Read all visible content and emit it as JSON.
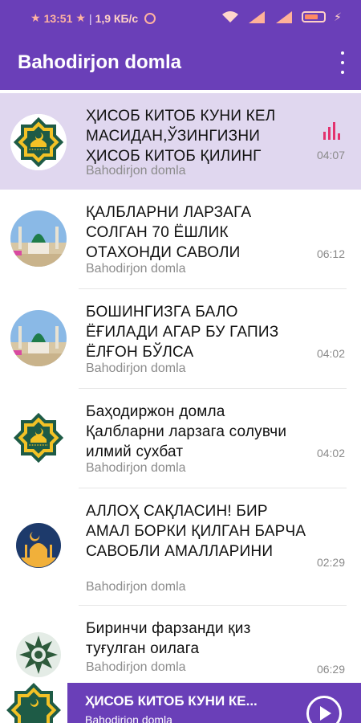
{
  "status_bar": {
    "time": "13:51",
    "star_left": "★",
    "star_right": "★",
    "separator": "|",
    "speed": "1,9 КБ/с",
    "accent_color": "#ff8a65"
  },
  "app_bar": {
    "title": "Bahodirjon domla",
    "menu_icon": "more-vert-icon",
    "color": "#6a3fb8"
  },
  "tracks": [
    {
      "title": "ҲИСОБ КИТОБ КУНИ КЕЛ МАСИДАН,ЎЗИНГИЗНИ ҲИСОБ КИТОБ ҚИЛИНГ",
      "artist": "Bahodirjon domla",
      "duration": "04:07",
      "playing": true,
      "thumb": "octagram-mosque-icon"
    },
    {
      "title": "ҚАЛБЛАРНИ ЛАРЗАГА СОЛГАН 70 ЁШЛИК ОТАХОНДИ САВОЛИ",
      "artist": "Bahodirjon domla",
      "duration": "06:12",
      "playing": false,
      "thumb": "mosque-photo-icon"
    },
    {
      "title": "БОШИНГИЗГА БАЛО ЁҒИЛАДИ АГАР БУ ГАПИЗ ЁЛҒОН БЎЛСА",
      "artist": "Bahodirjon domla",
      "duration": "04:02",
      "playing": false,
      "thumb": "mosque-photo-icon"
    },
    {
      "title": "Баҳодиржон домла Қалбларни ларзага солувчи илмий сухбат",
      "artist": "Bahodirjon domla",
      "duration": "04:02",
      "playing": false,
      "thumb": "octagram-mosque-icon"
    },
    {
      "title": "АЛЛОҲ САҚЛАСИН! БИР АМАЛ БОРКИ ҚИЛГАН БАРЧА САВОБЛИ АМАЛЛАРИНИ",
      "artist": "Bahodirjon domla",
      "duration": "02:29",
      "playing": false,
      "thumb": "mosque-night-icon"
    },
    {
      "title": "Биринчи фарзанди қиз туғулган оилага",
      "artist": "Bahodirjon domla",
      "duration": "06:29",
      "playing": false,
      "thumb": "ornament-icon"
    }
  ],
  "player": {
    "title": "ҲИСОБ КИТОБ КУНИ КЕ...",
    "artist": "Bahodirjon domla",
    "play_icon": "play-icon"
  }
}
